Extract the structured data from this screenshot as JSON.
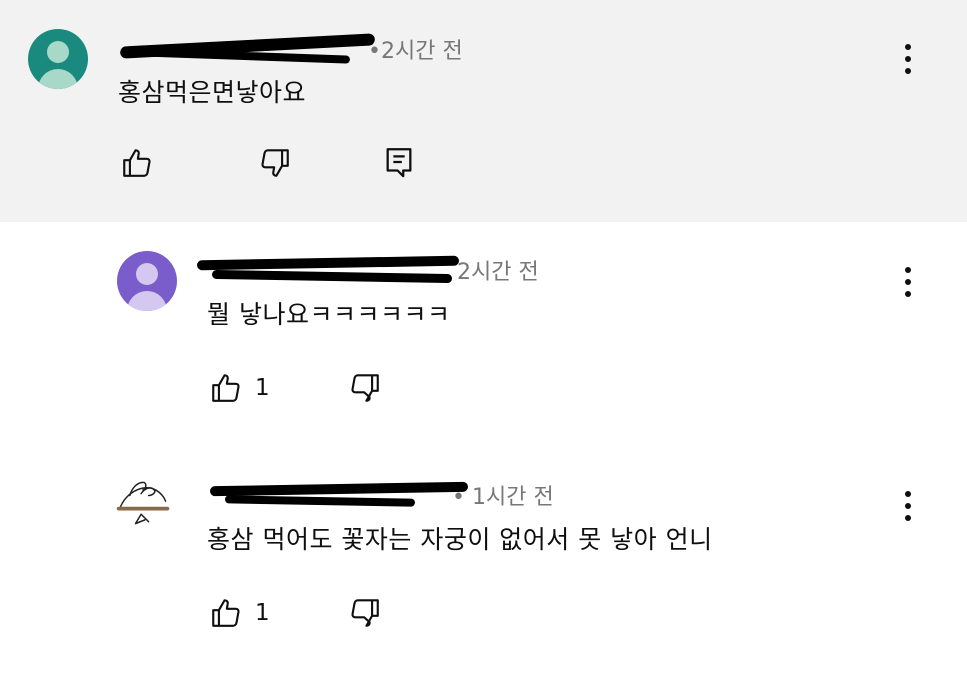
{
  "comments": [
    {
      "time": "•2시간 전",
      "text": "홍삼먹은면낳아요",
      "avatar_color": "#1a8a7e",
      "avatar_body_color": "#a8d8c8",
      "likes": "",
      "actions": [
        "like-icon",
        "dislike-icon",
        "reply-icon",
        "more-vert-icon"
      ]
    },
    {
      "time": "2시간 전",
      "text": "뭘 낳나요ㅋㅋㅋㅋㅋㅋ",
      "avatar_color": "#7b5ccb",
      "avatar_body_color": "#d4c8f0",
      "likes": "1",
      "actions": [
        "like-icon",
        "dislike-icon",
        "more-vert-icon"
      ]
    },
    {
      "time": "• 1시간 전",
      "text": "홍삼 먹어도 꽃자는 자궁이 없어서 못 낳아 언니",
      "avatar_color": "#ffffff",
      "likes": "1",
      "actions": [
        "like-icon",
        "dislike-icon",
        "more-vert-icon"
      ]
    }
  ]
}
